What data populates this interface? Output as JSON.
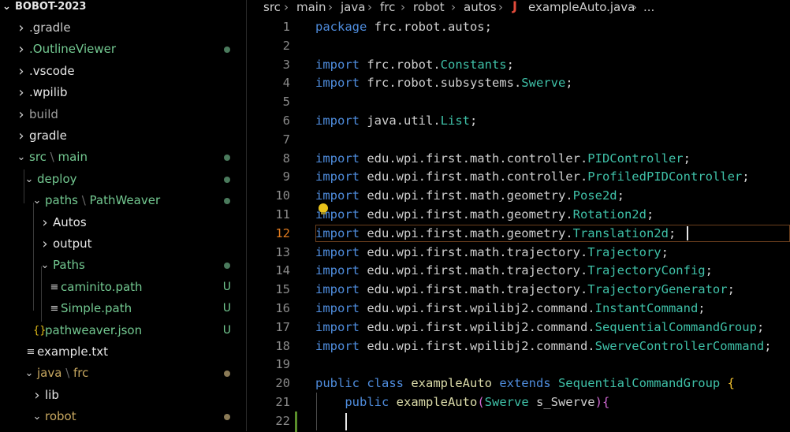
{
  "explorer": {
    "root_label": "BOBOT-2023",
    "items": [
      {
        "label": ".gradle",
        "color": "#cccccc"
      },
      {
        "label": ".OutlineViewer",
        "color": "#73c991",
        "status": "dot"
      },
      {
        "label": ".vscode",
        "color": "#e6e6e6"
      },
      {
        "label": ".wpilib",
        "color": "#e6e6e6"
      },
      {
        "label": "build",
        "color": "#a0a0a0"
      },
      {
        "label": "gradle",
        "color": "#e6e6e6"
      },
      {
        "label": "src",
        "label2": "main",
        "color": "#73c991",
        "status": "dot"
      },
      {
        "label": "deploy",
        "color": "#73c991",
        "status": "dot"
      },
      {
        "label": "paths",
        "label2": "PathWeaver",
        "color": "#73c991",
        "status": "dot"
      },
      {
        "label": "Autos",
        "color": "#e6e6e6"
      },
      {
        "label": "output",
        "color": "#e6e6e6"
      },
      {
        "label": "Paths",
        "color": "#73c991",
        "status": "dot"
      },
      {
        "label": "caminito.path",
        "color": "#73c991",
        "status": "U"
      },
      {
        "label": "Simple.path",
        "color": "#73c991",
        "status": "U"
      },
      {
        "label": "pathweaver.json",
        "color": "#73c991",
        "status": "U",
        "icon": "{}"
      },
      {
        "label": "example.txt",
        "color": "#e6e6e6"
      },
      {
        "label": "java",
        "label2": "frc",
        "color": "#c8a860",
        "status": "dot"
      },
      {
        "label": "lib",
        "color": "#e6e6e6"
      },
      {
        "label": "robot",
        "color": "#c8a860",
        "status": "dot"
      }
    ]
  },
  "breadcrumb": {
    "parts": [
      "src",
      "main",
      "java",
      "frc",
      "robot",
      "autos"
    ],
    "file": "exampleAuto.java",
    "trailing": "..."
  },
  "editor": {
    "active_line": 12,
    "lines": [
      {
        "n": "1",
        "t": [
          [
            "kw",
            "package "
          ],
          [
            "pkg",
            "frc.robot.autos"
          ],
          [
            "",
            "; "
          ]
        ]
      },
      {
        "n": "2",
        "t": []
      },
      {
        "n": "3",
        "t": [
          [
            "kw",
            "import "
          ],
          [
            "pkg",
            "frc.robot."
          ],
          [
            "cls",
            "Constants"
          ],
          [
            "",
            ";"
          ]
        ]
      },
      {
        "n": "4",
        "t": [
          [
            "kw",
            "import "
          ],
          [
            "pkg",
            "frc.robot.subsystems."
          ],
          [
            "cls",
            "Swerve"
          ],
          [
            "",
            ";"
          ]
        ]
      },
      {
        "n": "5",
        "t": []
      },
      {
        "n": "6",
        "t": [
          [
            "kw",
            "import "
          ],
          [
            "pkg",
            "java.util."
          ],
          [
            "cls",
            "List"
          ],
          [
            "",
            ";"
          ]
        ]
      },
      {
        "n": "7",
        "t": []
      },
      {
        "n": "8",
        "t": [
          [
            "kw",
            "import "
          ],
          [
            "pkg",
            "edu.wpi.first.math.controller."
          ],
          [
            "cls",
            "PIDController"
          ],
          [
            "",
            ";"
          ]
        ]
      },
      {
        "n": "9",
        "t": [
          [
            "kw",
            "import "
          ],
          [
            "pkg",
            "edu.wpi.first.math.controller."
          ],
          [
            "cls",
            "ProfiledPIDController"
          ],
          [
            "",
            ";"
          ]
        ]
      },
      {
        "n": "10",
        "t": [
          [
            "kw",
            "import "
          ],
          [
            "pkg",
            "edu.wpi.first.math.geometry."
          ],
          [
            "cls",
            "Pose2d"
          ],
          [
            "",
            ";"
          ]
        ]
      },
      {
        "n": "11",
        "t": [
          [
            "kw",
            "import "
          ],
          [
            "pkg",
            "edu.wpi.first.math.geometry."
          ],
          [
            "cls",
            "Rotation2d"
          ],
          [
            "",
            ";"
          ]
        ]
      },
      {
        "n": "12",
        "t": [
          [
            "kw",
            "import "
          ],
          [
            "pkg",
            "edu.wpi.first.math.geometry."
          ],
          [
            "cls",
            "Translation2d"
          ],
          [
            "",
            ";"
          ]
        ]
      },
      {
        "n": "13",
        "t": [
          [
            "kw",
            "import "
          ],
          [
            "pkg",
            "edu.wpi.first.math.trajectory."
          ],
          [
            "cls",
            "Trajectory"
          ],
          [
            "",
            ";"
          ]
        ]
      },
      {
        "n": "14",
        "t": [
          [
            "kw",
            "import "
          ],
          [
            "pkg",
            "edu.wpi.first.math.trajectory."
          ],
          [
            "cls",
            "TrajectoryConfig"
          ],
          [
            "",
            ";"
          ]
        ]
      },
      {
        "n": "15",
        "t": [
          [
            "kw",
            "import "
          ],
          [
            "pkg",
            "edu.wpi.first.math.trajectory."
          ],
          [
            "cls",
            "TrajectoryGenerator"
          ],
          [
            "",
            ";"
          ]
        ]
      },
      {
        "n": "16",
        "t": [
          [
            "kw",
            "import "
          ],
          [
            "pkg",
            "edu.wpi.first.wpilibj2.command."
          ],
          [
            "cls",
            "InstantCommand"
          ],
          [
            "",
            ";"
          ]
        ]
      },
      {
        "n": "17",
        "t": [
          [
            "kw",
            "import "
          ],
          [
            "pkg",
            "edu.wpi.first.wpilibj2.command."
          ],
          [
            "cls",
            "SequentialCommandGroup"
          ],
          [
            "",
            ";"
          ]
        ]
      },
      {
        "n": "18",
        "t": [
          [
            "kw",
            "import "
          ],
          [
            "pkg",
            "edu.wpi.first.wpilibj2.command."
          ],
          [
            "cls",
            "SwerveControllerCommand"
          ],
          [
            "",
            ";"
          ]
        ]
      },
      {
        "n": "19",
        "t": []
      },
      {
        "n": "20",
        "t": [
          [
            "kw",
            "public "
          ],
          [
            "kw",
            "class "
          ],
          [
            "fn",
            "exampleAuto "
          ],
          [
            "kw",
            "extends "
          ],
          [
            "cls",
            "SequentialCommandGroup "
          ],
          [
            "br",
            "{"
          ]
        ]
      },
      {
        "n": "21",
        "t": [
          [
            "",
            "    "
          ],
          [
            "kw",
            "public "
          ],
          [
            "fn",
            "exampleAuto"
          ],
          [
            "br2",
            "("
          ],
          [
            "cls",
            "Swerve "
          ],
          [
            "pkg",
            "s_Swerve"
          ],
          [
            "br2",
            ")"
          ],
          [
            "br2",
            "{"
          ]
        ]
      },
      {
        "n": "22",
        "t": []
      }
    ]
  }
}
